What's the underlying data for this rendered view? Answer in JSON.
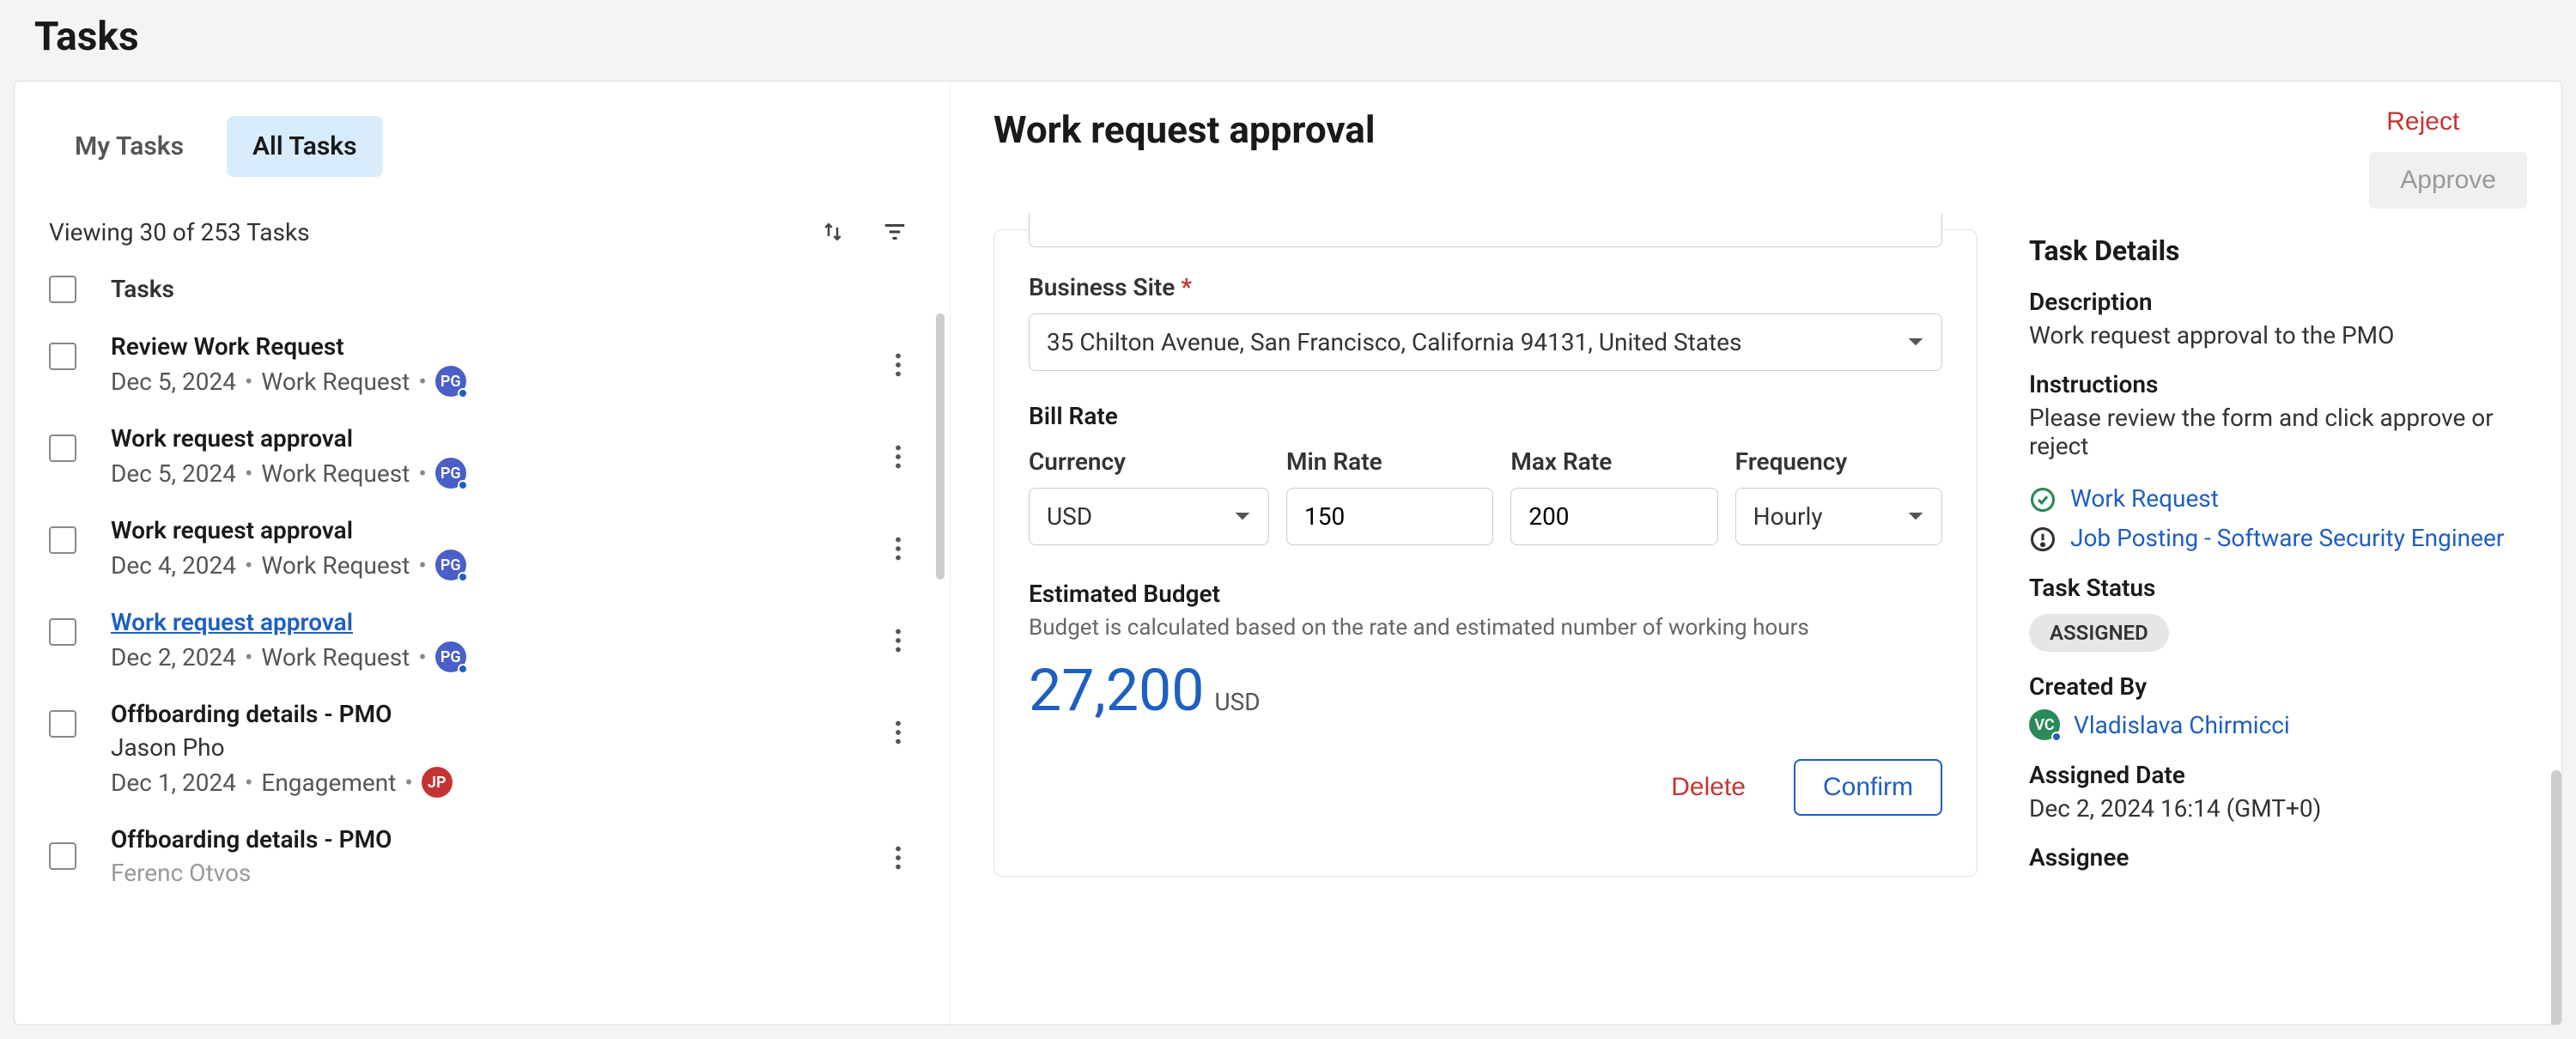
{
  "page": {
    "title": "Tasks"
  },
  "tabs": {
    "my": "My Tasks",
    "all": "All Tasks"
  },
  "list": {
    "viewing": "Viewing 30 of 253 Tasks",
    "header": "Tasks",
    "items": [
      {
        "title": "Review Work Request",
        "date": "Dec 5, 2024",
        "type": "Work Request",
        "avatar_initials": "PG",
        "avatar_color": "blue"
      },
      {
        "title": "Work request approval",
        "date": "Dec 5, 2024",
        "type": "Work Request",
        "avatar_initials": "PG",
        "avatar_color": "blue"
      },
      {
        "title": "Work request approval",
        "date": "Dec 4, 2024",
        "type": "Work Request",
        "avatar_initials": "PG",
        "avatar_color": "blue"
      },
      {
        "title": "Work request approval",
        "date": "Dec 2, 2024",
        "type": "Work Request",
        "avatar_initials": "PG",
        "avatar_color": "blue",
        "active": true
      },
      {
        "title": "Offboarding details - PMO",
        "subtitle": "Jason Pho",
        "date": "Dec 1, 2024",
        "type": "Engagement",
        "avatar_initials": "JP",
        "avatar_color": "red"
      },
      {
        "title": "Offboarding details - PMO",
        "subtitle": "Ferenc Otvos"
      }
    ]
  },
  "detail": {
    "title": "Work request approval",
    "reject_label": "Reject",
    "approve_label": "Approve",
    "business_site_label": "Business Site",
    "business_site_value": "35 Chilton Avenue, San Francisco, California 94131, United States",
    "bill_rate_label": "Bill Rate",
    "currency_label": "Currency",
    "currency_value": "USD",
    "min_rate_label": "Min Rate",
    "min_rate_value": "150",
    "max_rate_label": "Max Rate",
    "max_rate_value": "200",
    "frequency_label": "Frequency",
    "frequency_value": "Hourly",
    "budget_label": "Estimated Budget",
    "budget_help": "Budget is calculated based on the rate and estimated number of working hours",
    "budget_amount": "27,200",
    "budget_currency": "USD",
    "delete_label": "Delete",
    "confirm_label": "Confirm"
  },
  "side": {
    "title": "Task Details",
    "description_label": "Description",
    "description_text": "Work request approval to the PMO",
    "instructions_label": "Instructions",
    "instructions_text": "Please review the form and click approve or reject",
    "link1": "Work Request",
    "link2": "Job Posting - Software Security Engineer",
    "status_label": "Task Status",
    "status_value": "ASSIGNED",
    "created_by_label": "Created By",
    "creator_initials": "VC",
    "creator_name": "Vladislava Chirmicci",
    "assigned_date_label": "Assigned Date",
    "assigned_date_value": "Dec 2, 2024 16:14 (GMT+0)",
    "assignee_label": "Assignee"
  }
}
